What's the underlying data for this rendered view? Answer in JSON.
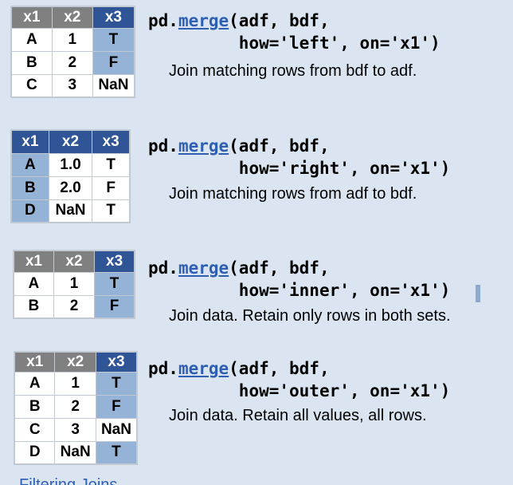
{
  "blocks": [
    {
      "headers": [
        "x1",
        "x2",
        "x3"
      ],
      "rows": [
        [
          "A",
          "1",
          "T"
        ],
        [
          "B",
          "2",
          "F"
        ],
        [
          "C",
          "3",
          "NaN"
        ]
      ],
      "code": {
        "prefix": "pd.",
        "func": "merge",
        "line1_rest": "(adf, bdf,",
        "line2": "how='left', on='x1')"
      },
      "description": "Join matching rows from bdf to adf."
    },
    {
      "headers": [
        "x1",
        "x2",
        "x3"
      ],
      "rows": [
        [
          "A",
          "1.0",
          "T"
        ],
        [
          "B",
          "2.0",
          "F"
        ],
        [
          "D",
          "NaN",
          "T"
        ]
      ],
      "code": {
        "prefix": "pd.",
        "func": "merge",
        "line1_rest": "(adf, bdf,",
        "line2": "how='right', on='x1')"
      },
      "description": "Join matching rows from adf to bdf."
    },
    {
      "headers": [
        "x1",
        "x2",
        "x3"
      ],
      "rows": [
        [
          "A",
          "1",
          "T"
        ],
        [
          "B",
          "2",
          "F"
        ]
      ],
      "code": {
        "prefix": "pd.",
        "func": "merge",
        "line1_rest": "(adf, bdf,",
        "line2": "how='inner', on='x1')"
      },
      "description": "Join data. Retain only rows in both sets."
    },
    {
      "headers": [
        "x1",
        "x2",
        "x3"
      ],
      "rows": [
        [
          "A",
          "1",
          "T"
        ],
        [
          "B",
          "2",
          "F"
        ],
        [
          "C",
          "3",
          "NaN"
        ],
        [
          "D",
          "NaN",
          "T"
        ]
      ],
      "code": {
        "prefix": "pd.",
        "func": "merge",
        "line1_rest": "(adf, bdf,",
        "line2": "how='outer', on='x1')"
      },
      "description": "Join data. Retain all values, all rows."
    }
  ],
  "partial_heading": "Filtering Joins",
  "colors": {
    "background": "#dbe5f1",
    "header_blue": "#2f5597",
    "header_gray": "#808080",
    "cell_blue": "#95b3d7",
    "cell_white": "#ffffff",
    "link_blue": "#2e5fb3"
  }
}
